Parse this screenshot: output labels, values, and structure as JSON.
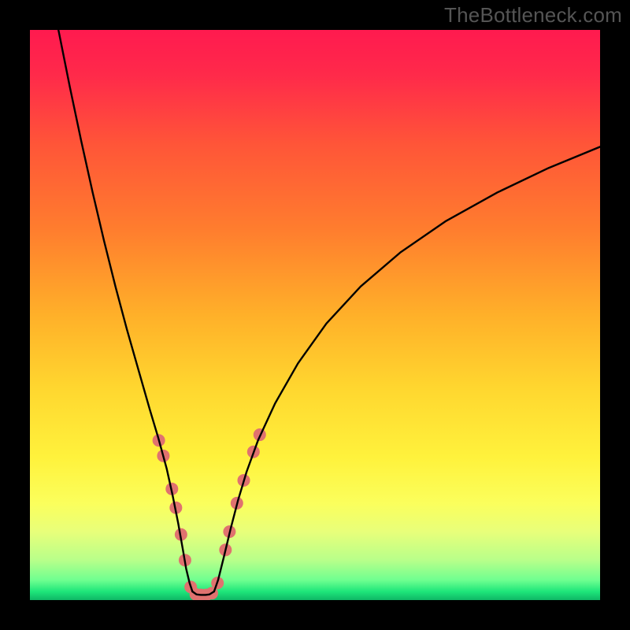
{
  "watermark": "TheBottleneck.com",
  "chart_data": {
    "type": "line",
    "title": "",
    "xlabel": "",
    "ylabel": "",
    "xlim": [
      0,
      100
    ],
    "ylim": [
      0,
      100
    ],
    "background_gradient": {
      "stops": [
        {
          "offset": 0,
          "color": "#ff1a4f"
        },
        {
          "offset": 0.08,
          "color": "#ff2a4a"
        },
        {
          "offset": 0.2,
          "color": "#ff5538"
        },
        {
          "offset": 0.35,
          "color": "#ff7d2e"
        },
        {
          "offset": 0.5,
          "color": "#ffb029"
        },
        {
          "offset": 0.63,
          "color": "#ffd72f"
        },
        {
          "offset": 0.75,
          "color": "#fff23c"
        },
        {
          "offset": 0.83,
          "color": "#fbff5c"
        },
        {
          "offset": 0.88,
          "color": "#e8ff7a"
        },
        {
          "offset": 0.93,
          "color": "#b8ff8a"
        },
        {
          "offset": 0.965,
          "color": "#6fff90"
        },
        {
          "offset": 0.985,
          "color": "#1ee67a"
        },
        {
          "offset": 1.0,
          "color": "#0fb765"
        }
      ]
    },
    "series": [
      {
        "name": "left-curve",
        "type": "line",
        "color": "#000000",
        "x": [
          5,
          7,
          9,
          11,
          13,
          15,
          17,
          19,
          21,
          22.5,
          24,
          25,
          26,
          26.8,
          27.4,
          28,
          28.5
        ],
        "y": [
          100,
          90,
          80.5,
          71.5,
          63,
          55,
          47.5,
          40.5,
          33.5,
          28.5,
          23,
          18.5,
          13.5,
          9,
          5.5,
          3,
          1.5
        ]
      },
      {
        "name": "valley-floor",
        "type": "line",
        "color": "#000000",
        "x": [
          28.5,
          29.2,
          30,
          30.8,
          31.5,
          32.3
        ],
        "y": [
          1.5,
          1.0,
          0.9,
          0.9,
          1.0,
          1.5
        ]
      },
      {
        "name": "right-curve",
        "type": "line",
        "color": "#000000",
        "x": [
          32.3,
          33,
          34,
          35.2,
          36.5,
          38,
          40,
          43,
          47,
          52,
          58,
          65,
          73,
          82,
          91,
          100
        ],
        "y": [
          1.5,
          3.5,
          7.5,
          12.5,
          17.5,
          22.5,
          28,
          34.5,
          41.5,
          48.5,
          55,
          61,
          66.5,
          71.5,
          75.8,
          79.5
        ]
      }
    ],
    "highlight_dots": {
      "color": "#e0726f",
      "radius_px": 8,
      "points": [
        {
          "x": 22.6,
          "y": 28.0
        },
        {
          "x": 23.4,
          "y": 25.3
        },
        {
          "x": 24.9,
          "y": 19.5
        },
        {
          "x": 25.6,
          "y": 16.2
        },
        {
          "x": 26.5,
          "y": 11.5
        },
        {
          "x": 27.2,
          "y": 7.0
        },
        {
          "x": 28.2,
          "y": 2.3
        },
        {
          "x": 29.1,
          "y": 1.0
        },
        {
          "x": 30.0,
          "y": 0.9
        },
        {
          "x": 30.9,
          "y": 0.9
        },
        {
          "x": 31.9,
          "y": 1.2
        },
        {
          "x": 32.9,
          "y": 3.0
        },
        {
          "x": 34.3,
          "y": 8.8
        },
        {
          "x": 35.0,
          "y": 12.0
        },
        {
          "x": 36.3,
          "y": 17.0
        },
        {
          "x": 37.5,
          "y": 21.0
        },
        {
          "x": 39.2,
          "y": 26.0
        },
        {
          "x": 40.3,
          "y": 29.0
        }
      ]
    }
  }
}
